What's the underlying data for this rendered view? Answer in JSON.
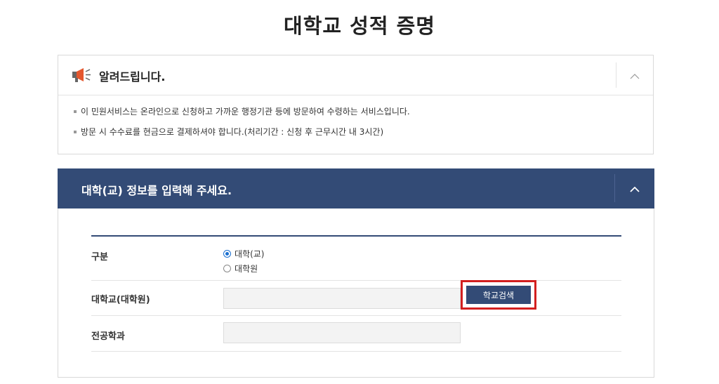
{
  "page": {
    "title": "대학교 성적 증명"
  },
  "notice": {
    "title": "알려드립니다.",
    "lines": [
      "이 민원서비스는 온라인으로 신청하고 가까운 행정기관 등에 방문하여 수령하는 서비스입니다.",
      "방문 시 수수료를 현금으로 결제하셔야 합니다.(처리기간 : 신청 후 근무시간 내 3시간)"
    ]
  },
  "form": {
    "header": "대학(교) 정보를 입력해 주세요.",
    "type_label": "구분",
    "type_options": [
      "대학(교)",
      "대학원"
    ],
    "type_selected": "대학(교)",
    "school_label": "대학교(대학원)",
    "school_value": "",
    "school_search_button": "학교검색",
    "major_label": "전공학과",
    "major_value": ""
  },
  "colors": {
    "header_bg": "#334b76",
    "highlight_border": "#d21f1f",
    "radio_accent": "#1a6fd0",
    "megaphone": "#e4572e"
  },
  "icons": {
    "notice": "megaphone-icon",
    "collapse": "chevron-up-icon"
  }
}
